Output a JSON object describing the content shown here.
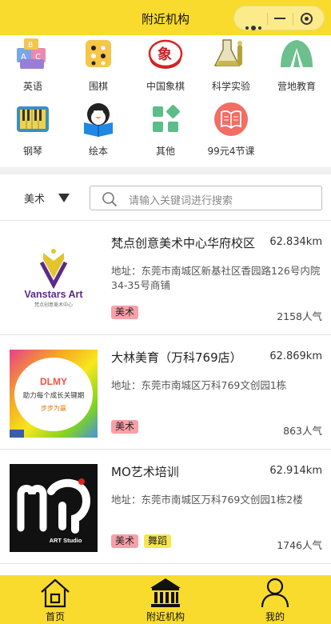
{
  "header": {
    "title": "附近机构"
  },
  "categories": [
    {
      "label": "英语",
      "icon": "abc-blocks-icon"
    },
    {
      "label": "围棋",
      "icon": "go-board-icon"
    },
    {
      "label": "中国象棋",
      "icon": "chinese-chess-icon"
    },
    {
      "label": "科学实验",
      "icon": "lab-flask-icon"
    },
    {
      "label": "营地教育",
      "icon": "camp-tent-icon"
    },
    {
      "label": "钢琴",
      "icon": "piano-icon"
    },
    {
      "label": "绘本",
      "icon": "picture-book-icon"
    },
    {
      "label": "其他",
      "icon": "grid-other-icon"
    },
    {
      "label": "99元4节课",
      "icon": "book-promo-icon"
    }
  ],
  "filter": {
    "category": "美术",
    "search_placeholder": "请输入关键词进行搜索"
  },
  "institutions": [
    {
      "name": "梵点创意美术中心华府校区",
      "distance": "62.834km",
      "address": "地址：东莞市南城区新基社区香园路126号内院34-35号商铺",
      "tags": [
        {
          "label": "美术"
        }
      ],
      "popularity": "2158人气",
      "logo": {
        "brand": "Vanstars Art",
        "sub": "梵点创意美术中心"
      }
    },
    {
      "name": "大林美育（万科769店）",
      "distance": "62.869km",
      "address": "地址：东莞市南城区万科769文创园1栋",
      "tags": [
        {
          "label": "美术"
        }
      ],
      "popularity": "863人气",
      "logo": {
        "line1": "助力每个成长关键期",
        "line2": "步步为赢"
      }
    },
    {
      "name": "MO艺术培训",
      "distance": "62.914km",
      "address": "地址：东莞市南城区万科769文创园1栋2楼",
      "tags": [
        {
          "label": "美术"
        },
        {
          "label": "舞蹈"
        }
      ],
      "popularity": "1746人气",
      "logo": {
        "brand": "ART Studio"
      }
    }
  ],
  "tabbar": [
    {
      "label": "首页",
      "icon": "home-icon"
    },
    {
      "label": "附近机构",
      "icon": "institution-icon"
    },
    {
      "label": "我的",
      "icon": "profile-icon"
    }
  ],
  "colors": {
    "brand_yellow": "#f8db2c",
    "tag_art": "#f8a0a8",
    "tag_dance": "#f6e74a"
  }
}
